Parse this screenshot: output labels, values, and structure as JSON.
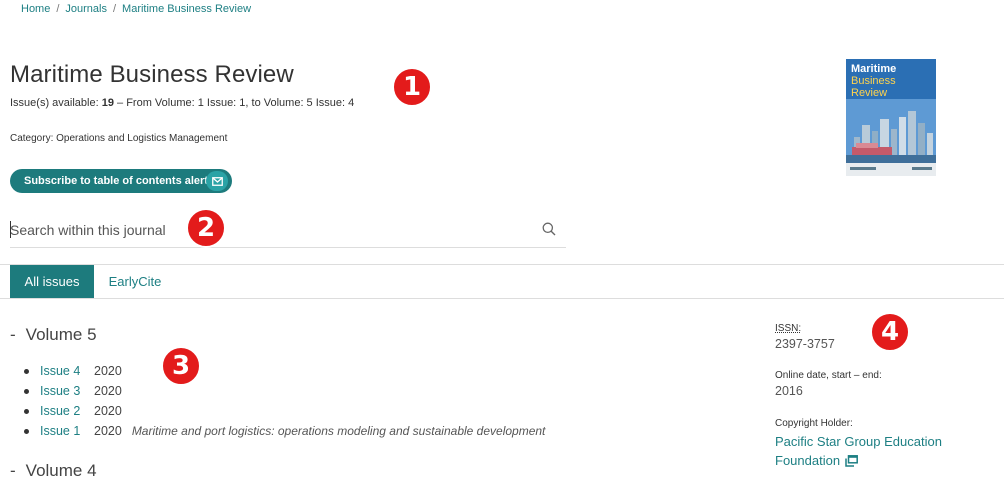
{
  "breadcrumb": {
    "items": [
      "Home",
      "Journals",
      "Maritime Business Review"
    ],
    "separator": "/"
  },
  "journal": {
    "title": "Maritime Business Review",
    "issues_prefix": "Issue(s) available: ",
    "issues_count": "19",
    "issues_suffix": " – From Volume: 1 Issue: 1, to Volume: 5 Issue: 4",
    "category_label": "Category: ",
    "category_value": "Operations and Logistics Management"
  },
  "subscribe": {
    "label": "Subscribe to table of contents alerts",
    "icon": "mail-icon"
  },
  "search": {
    "placeholder": "Search within this journal",
    "value": "",
    "icon": "search-icon"
  },
  "tabs": [
    {
      "label": "All issues",
      "active": true
    },
    {
      "label": "EarlyCite",
      "active": false
    }
  ],
  "volumes": [
    {
      "label": "Volume 5",
      "toggle": "-",
      "issues": [
        {
          "label": "Issue 4",
          "year": "2020",
          "description": ""
        },
        {
          "label": "Issue 3",
          "year": "2020",
          "description": ""
        },
        {
          "label": "Issue 2",
          "year": "2020",
          "description": ""
        },
        {
          "label": "Issue 1",
          "year": "2020",
          "description": "Maritime and port logistics: operations modeling and sustainable development"
        }
      ]
    },
    {
      "label": "Volume 4",
      "toggle": "-",
      "issues": []
    }
  ],
  "sidebar": {
    "issn_label": "ISSN:",
    "issn_value": "2397-3757",
    "date_label": "Online date, start – end:",
    "date_value": "2016",
    "holder_label": "Copyright Holder:",
    "holder_value": "Pacific Star Group Education Foundation"
  },
  "cover": {
    "title_line1": "Maritime",
    "title_line2": "Business",
    "title_line3": "Review"
  },
  "annotations": [
    "1",
    "2",
    "3",
    "4"
  ],
  "colors": {
    "accent": "#1d7b7d",
    "link": "#1d7f83",
    "badge": "#e31b1b",
    "cover_blue": "#2b6fb4"
  }
}
